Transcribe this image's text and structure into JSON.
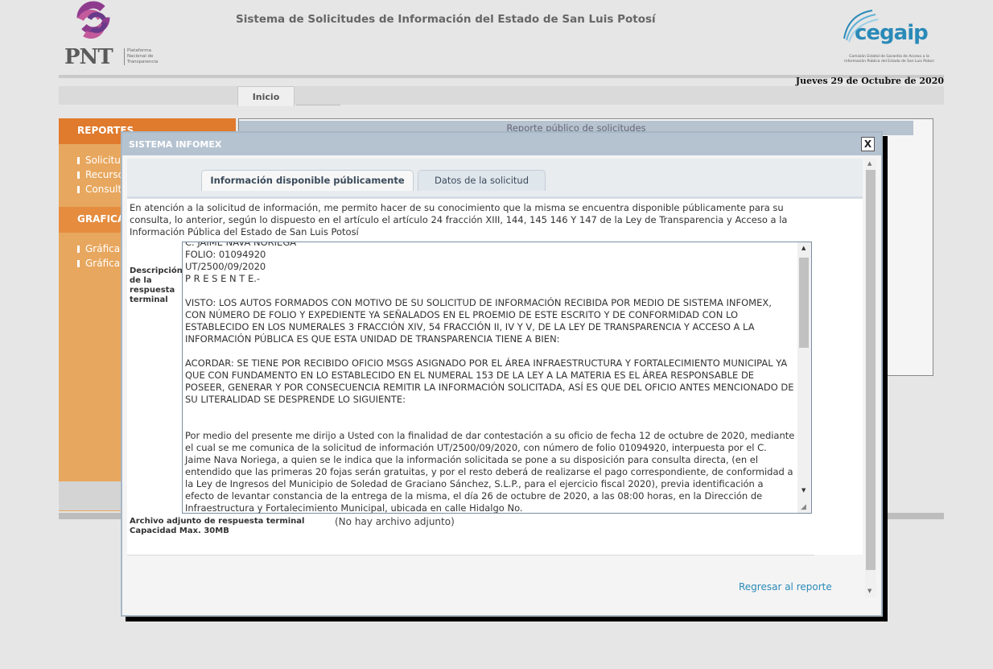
{
  "header": {
    "pnt_logo_text": "PNT",
    "pnt_subtitle": "Plataforma Nacional de Transparencia",
    "title": "Sistema de Solicitudes de Información del Estado de San Luis Potosí",
    "cegaip_logo_text": "cegaip",
    "cegaip_subtitle": "Comisión Estatal de Garantía de Acceso a la Información Pública del Estado de San Luis Potosí",
    "date": "Jueves 29 de Octubre de 2020"
  },
  "nav": {
    "inicio_tab": "Inicio"
  },
  "sidebar": {
    "reportes_title": "REPORTES",
    "reportes_items": [
      "Solicitudes",
      "Recursos",
      "Consultas"
    ],
    "graficas_title": "GRAFICAS",
    "graficas_items": [
      "Gráficas",
      "Gráficas"
    ]
  },
  "report": {
    "title": "Reporte público de solicitudes"
  },
  "modal": {
    "title": "SISTEMA INFOMEX",
    "close_label": "X",
    "tabs": [
      "Información disponible públicamente",
      "Datos de la solicitud"
    ],
    "intro": "En atención a la solicitud de información, me permito hacer de su conocimiento que la misma se encuentra disponible públicamente para su consulta, lo anterior, según lo dispuesto en el artículo el artículo 24 fracción XIII, 144, 145 146 Y 147 de la Ley de Transparencia y Acceso a la Información Pública del Estado de San Luis Potosí",
    "description_label": "Descripción de la respuesta terminal",
    "description_text": "C. JAIME NAVA NORIEGA\nFOLIO: 01094920\nUT/2500/09/2020\nP R E S E N T E.-\n\nVISTO: LOS AUTOS FORMADOS CON MOTIVO DE SU SOLICITUD DE INFORMACIÓN RECIBIDA POR MEDIO DE SISTEMA INFOMEX, CON NÚMERO DE FOLIO Y EXPEDIENTE YA SEÑALADOS EN EL PROEMIO DE ESTE ESCRITO Y DE CONFORMIDAD CON LO ESTABLECIDO EN LOS NUMERALES 3 FRACCIÓN XIV, 54 FRACCIÓN II, IV Y V, DE LA LEY DE TRANSPARENCIA Y ACCESO A LA INFORMACIÓN PÚBLICA ES QUE ESTA UNIDAD DE TRANSPARENCIA TIENE A BIEN:\n\nACORDAR: SE TIENE POR RECIBIDO OFICIO MSGS ASIGNADO POR EL ÁREA INFRAESTRUCTURA Y FORTALECIMIENTO MUNICIPAL YA QUE CON FUNDAMENTO EN LO ESTABLECIDO EN EL NUMERAL 153 DE LA LEY A LA MATERIA ES EL ÁREA RESPONSABLE DE POSEER, GENERAR Y POR CONSECUENCIA REMITIR LA INFORMACIÓN SOLICITADA, ASÍ ES QUE DEL OFICIO ANTES MENCIONADO DE SU LITERALIDAD SE DESPRENDE LO SIGUIENTE:\n\n\nPor medio del presente me dirijo a Usted con la finalidad de dar contestación a su oficio de fecha 12 de octubre de 2020, mediante el cual se me comunica de la solicitud de información UT/2500/09/2020, con número de folio 01094920, interpuesta por el C. Jaime Nava Noriega, a quien se le indica que la información solicitada se pone a su disposición para consulta directa, (en el entendido que las primeras 20 fojas serán gratuitas, y por el resto deberá de realizarse el pago correspondiente, de conformidad a la Ley de Ingresos del Municipio de Soledad de Graciano Sánchez, S.L.P., para el ejercicio fiscal 2020), previa identificación a efecto de levantar constancia de la entrega de la misma, el día 26 de octubre de 2020, a las 08:00 horas, en la Dirección de Infraestructura y Fortalecimiento Municipal, ubicada en calle Hidalgo No.",
    "attachment_label_1": "Archivo adjunto de respuesta terminal",
    "attachment_label_2": "Capacidad Max. 30MB",
    "attachment_value": "(No hay archivo adjunto)",
    "back_link": "Regresar al reporte"
  }
}
